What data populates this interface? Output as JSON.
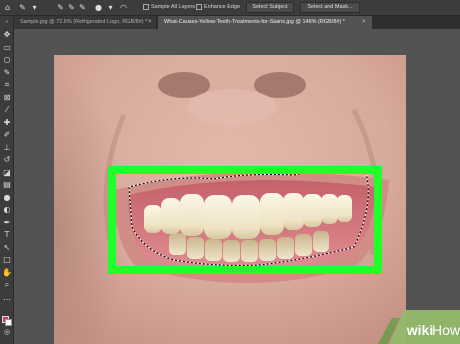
{
  "options_bar": {
    "sample_all_layers": "Sample All Layers",
    "enhance_edge": "Enhance Edge",
    "select_subject": "Select Subject",
    "select_and_mask": "Select and Mask..."
  },
  "tabs": [
    {
      "label": "Sample.jpg @ 72.6% (Refrigerated Logo, RGB/8#) *",
      "active": false
    },
    {
      "label": "What-Causes-Yellow-Teeth-Treatments-for-Stains.jpg @ 146% (RGB/8#) *",
      "active": true
    }
  ],
  "tab_close": "×",
  "tools": [
    {
      "icon": "move-icon",
      "glyph": "✥"
    },
    {
      "icon": "artboard-icon",
      "glyph": "▭"
    },
    {
      "icon": "lasso-icon",
      "glyph": "○"
    },
    {
      "icon": "quick-selection-icon",
      "glyph": "✎"
    },
    {
      "icon": "crop-icon",
      "glyph": "⌗"
    },
    {
      "icon": "frame-icon",
      "glyph": "⊠"
    },
    {
      "icon": "eyedropper-icon",
      "glyph": "⁄"
    },
    {
      "icon": "healing-brush-icon",
      "glyph": "✚"
    },
    {
      "icon": "brush-icon",
      "glyph": "✐"
    },
    {
      "icon": "clone-stamp-icon",
      "glyph": "⊥"
    },
    {
      "icon": "history-brush-icon",
      "glyph": "↺"
    },
    {
      "icon": "eraser-icon",
      "glyph": "◪"
    },
    {
      "icon": "gradient-icon",
      "glyph": "▤"
    },
    {
      "icon": "blur-icon",
      "glyph": "●"
    },
    {
      "icon": "dodge-icon",
      "glyph": "◐"
    },
    {
      "icon": "pen-icon",
      "glyph": "✒"
    },
    {
      "icon": "type-icon",
      "glyph": "T"
    },
    {
      "icon": "path-selection-icon",
      "glyph": "↖"
    },
    {
      "icon": "rectangle-icon",
      "glyph": "□"
    },
    {
      "icon": "hand-icon",
      "glyph": "✋"
    },
    {
      "icon": "zoom-icon",
      "glyph": "⌕"
    },
    {
      "icon": "more-tools-icon",
      "glyph": "…"
    }
  ],
  "colors": {
    "foreground": "#cc3d6a",
    "background": "#ffffff",
    "highlight_box": "#1fff2a",
    "accent": "#3aa0ff"
  },
  "watermark": {
    "brand": "wikiHow"
  }
}
